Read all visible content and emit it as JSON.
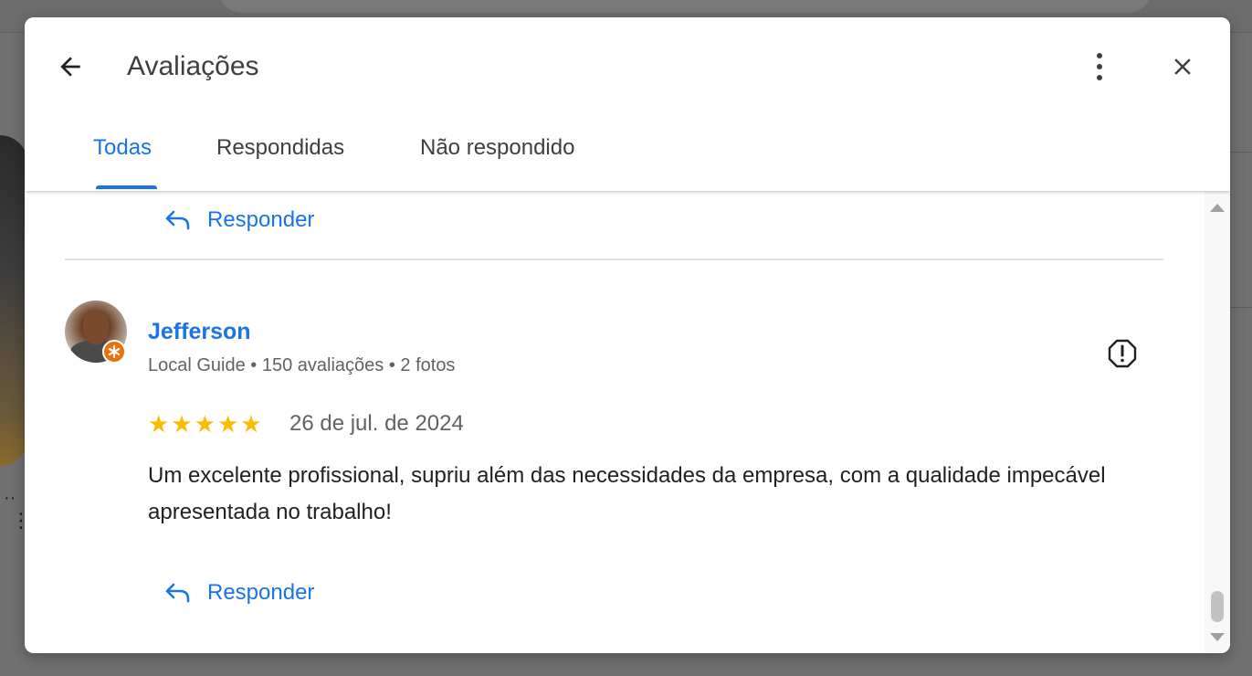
{
  "dialog": {
    "title": "Avaliações",
    "back_icon": "arrow-left-icon",
    "more_icon": "more-vert-icon",
    "close_icon": "close-icon"
  },
  "tabs": [
    {
      "label": "Todas",
      "active": true
    },
    {
      "label": "Respondidas",
      "active": false
    },
    {
      "label": "Não respondido",
      "active": false
    }
  ],
  "reply_label": "Responder",
  "review": {
    "name": "Jefferson",
    "meta": "Local Guide • 150 avaliações • 2 fotos",
    "rating": 5,
    "rating_max": 5,
    "date": "26 de jul. de 2024",
    "text": "Um excelente profissional, supriu além das necessidades da empresa, com a qualidade impecável apresentada no trabalho!"
  },
  "colors": {
    "accent": "#1a73e8",
    "star": "#fbbc04",
    "badge": "#e8710a"
  }
}
